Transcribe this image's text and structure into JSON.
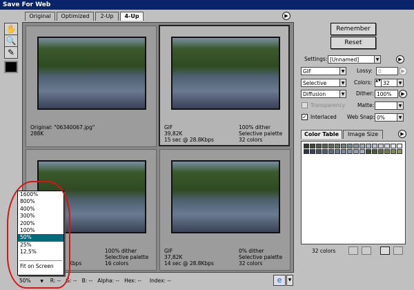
{
  "window": {
    "title": "Save For Web"
  },
  "tabs": [
    "Original",
    "Optimized",
    "2-Up",
    "4-Up"
  ],
  "panels": [
    {
      "l1": "Original: \"06340067.jpg\"",
      "l2": "288K",
      "l3": "",
      "r1": "",
      "r2": "",
      "r3": ""
    },
    {
      "l1": "GIF",
      "l2": "39,82K",
      "l3": "15 sec @ 28.8Kbps",
      "r1": "100% dither",
      "r2": "Selective palette",
      "r3": "32 colors"
    },
    {
      "l1": "",
      "l2": "",
      "l3": "Kbps",
      "r1": "100% dither",
      "r2": "Selective palette",
      "r3": "16 colors"
    },
    {
      "l1": "GIF",
      "l2": "37,82K",
      "l3": "14 sec @ 28.8Kbps",
      "r1": "0% dither",
      "r2": "Selective palette",
      "r3": "32 colors"
    }
  ],
  "buttons": {
    "remember": "Remember",
    "reset": "Reset"
  },
  "settings": {
    "label": "Settings:",
    "preset": "[Unnamed]",
    "format": "GIF",
    "reduction": "Selective",
    "dither_algo": "Diffusion",
    "lossy_label": "Lossy:",
    "lossy": "0",
    "colors_label": "Colors:",
    "colors": "32",
    "dither_label": "Dither:",
    "dither": "100%",
    "transparency": "Transparency",
    "interlaced": "Interlaced",
    "matte_label": "Matte:",
    "matte": "",
    "websnap_label": "Web Snap:",
    "websnap": "0%"
  },
  "color_table": {
    "tabs": [
      "Color Table",
      "Image Size"
    ],
    "count": "32 colors",
    "swatches": [
      "#2e3a2a",
      "#3d4a3a",
      "#4b5a46",
      "#55644d",
      "#5d6d57",
      "#677763",
      "#6f7f70",
      "#77898a",
      "#8495a3",
      "#9aa6b5",
      "#a7b3c2",
      "#b4bfce",
      "#c2cad6",
      "#d0d6df",
      "#dde1e8",
      "#e8ecf0",
      "#2b3448",
      "#364259",
      "#435069",
      "#4f5d78",
      "#5b6a85",
      "#687892",
      "#76869f",
      "#8494ac",
      "#93a2b8",
      "#a2b0c4",
      "#3e4f2c",
      "#4c5f34",
      "#5a6e3e",
      "#687d48",
      "#778c53",
      "#869a5f"
    ]
  },
  "zoom": {
    "options": [
      "1600%",
      "800%",
      "400%",
      "300%",
      "200%",
      "100%",
      "50%",
      "25%",
      "12.5%",
      "Fit on Screen"
    ],
    "selected": "50%",
    "current": "50%"
  },
  "status": {
    "r": "R:",
    "g": "G:",
    "b": "B:",
    "alpha": "Alpha:",
    "hex": "Hex:",
    "index": "Index:",
    "empty": "--"
  },
  "colors": {
    "titlebar": "#0a246a",
    "highlight": "#006b7c",
    "annotation": "#e01010"
  }
}
